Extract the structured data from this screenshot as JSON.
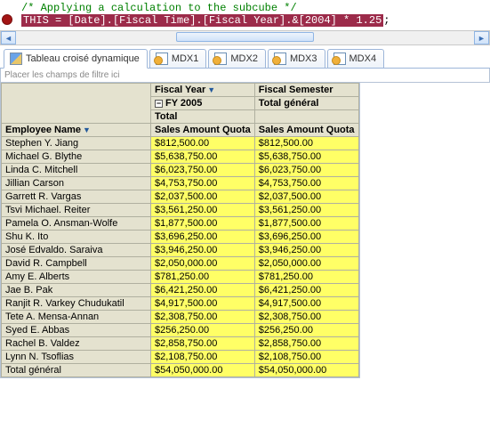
{
  "code": {
    "comment": "/* Applying a calculation to the subcube */",
    "highlight": "THIS = [Date].[Fiscal Time].[Fiscal Year].&[2004] * 1.25",
    "semicolon": ";"
  },
  "tabs": {
    "t0": "Tableau croisé dynamique",
    "t1": "MDX1",
    "t2": "MDX2",
    "t3": "MDX3",
    "t4": "MDX4"
  },
  "filter_placeholder": "Placer les champs de filtre ici",
  "headers": {
    "fiscal_year": "Fiscal Year",
    "fiscal_semester": "Fiscal Semester",
    "fy2005": "FY 2005",
    "total_general": "Total général",
    "total": "Total",
    "saq": "Sales Amount Quota",
    "employee": "Employee Name"
  },
  "rows": {
    "r0": {
      "n": "Stephen Y. Jiang",
      "a": "$812,500.00",
      "b": "$812,500.00"
    },
    "r1": {
      "n": "Michael G. Blythe",
      "a": "$5,638,750.00",
      "b": "$5,638,750.00"
    },
    "r2": {
      "n": "Linda C. Mitchell",
      "a": "$6,023,750.00",
      "b": "$6,023,750.00"
    },
    "r3": {
      "n": "Jillian Carson",
      "a": "$4,753,750.00",
      "b": "$4,753,750.00"
    },
    "r4": {
      "n": "Garrett R. Vargas",
      "a": "$2,037,500.00",
      "b": "$2,037,500.00"
    },
    "r5": {
      "n": "Tsvi Michael. Reiter",
      "a": "$3,561,250.00",
      "b": "$3,561,250.00"
    },
    "r6": {
      "n": "Pamela O. Ansman-Wolfe",
      "a": "$1,877,500.00",
      "b": "$1,877,500.00"
    },
    "r7": {
      "n": "Shu K. Ito",
      "a": "$3,696,250.00",
      "b": "$3,696,250.00"
    },
    "r8": {
      "n": "José Edvaldo. Saraiva",
      "a": "$3,946,250.00",
      "b": "$3,946,250.00"
    },
    "r9": {
      "n": "David R. Campbell",
      "a": "$2,050,000.00",
      "b": "$2,050,000.00"
    },
    "r10": {
      "n": "Amy E. Alberts",
      "a": "$781,250.00",
      "b": "$781,250.00"
    },
    "r11": {
      "n": "Jae B. Pak",
      "a": "$6,421,250.00",
      "b": "$6,421,250.00"
    },
    "r12": {
      "n": "Ranjit R. Varkey Chudukatil",
      "a": "$4,917,500.00",
      "b": "$4,917,500.00"
    },
    "r13": {
      "n": "Tete A. Mensa-Annan",
      "a": "$2,308,750.00",
      "b": "$2,308,750.00"
    },
    "r14": {
      "n": "Syed E. Abbas",
      "a": "$256,250.00",
      "b": "$256,250.00"
    },
    "r15": {
      "n": "Rachel B. Valdez",
      "a": "$2,858,750.00",
      "b": "$2,858,750.00"
    },
    "r16": {
      "n": "Lynn N. Tsoflias",
      "a": "$2,108,750.00",
      "b": "$2,108,750.00"
    },
    "r17": {
      "n": "Total général",
      "a": "$54,050,000.00",
      "b": "$54,050,000.00"
    }
  }
}
